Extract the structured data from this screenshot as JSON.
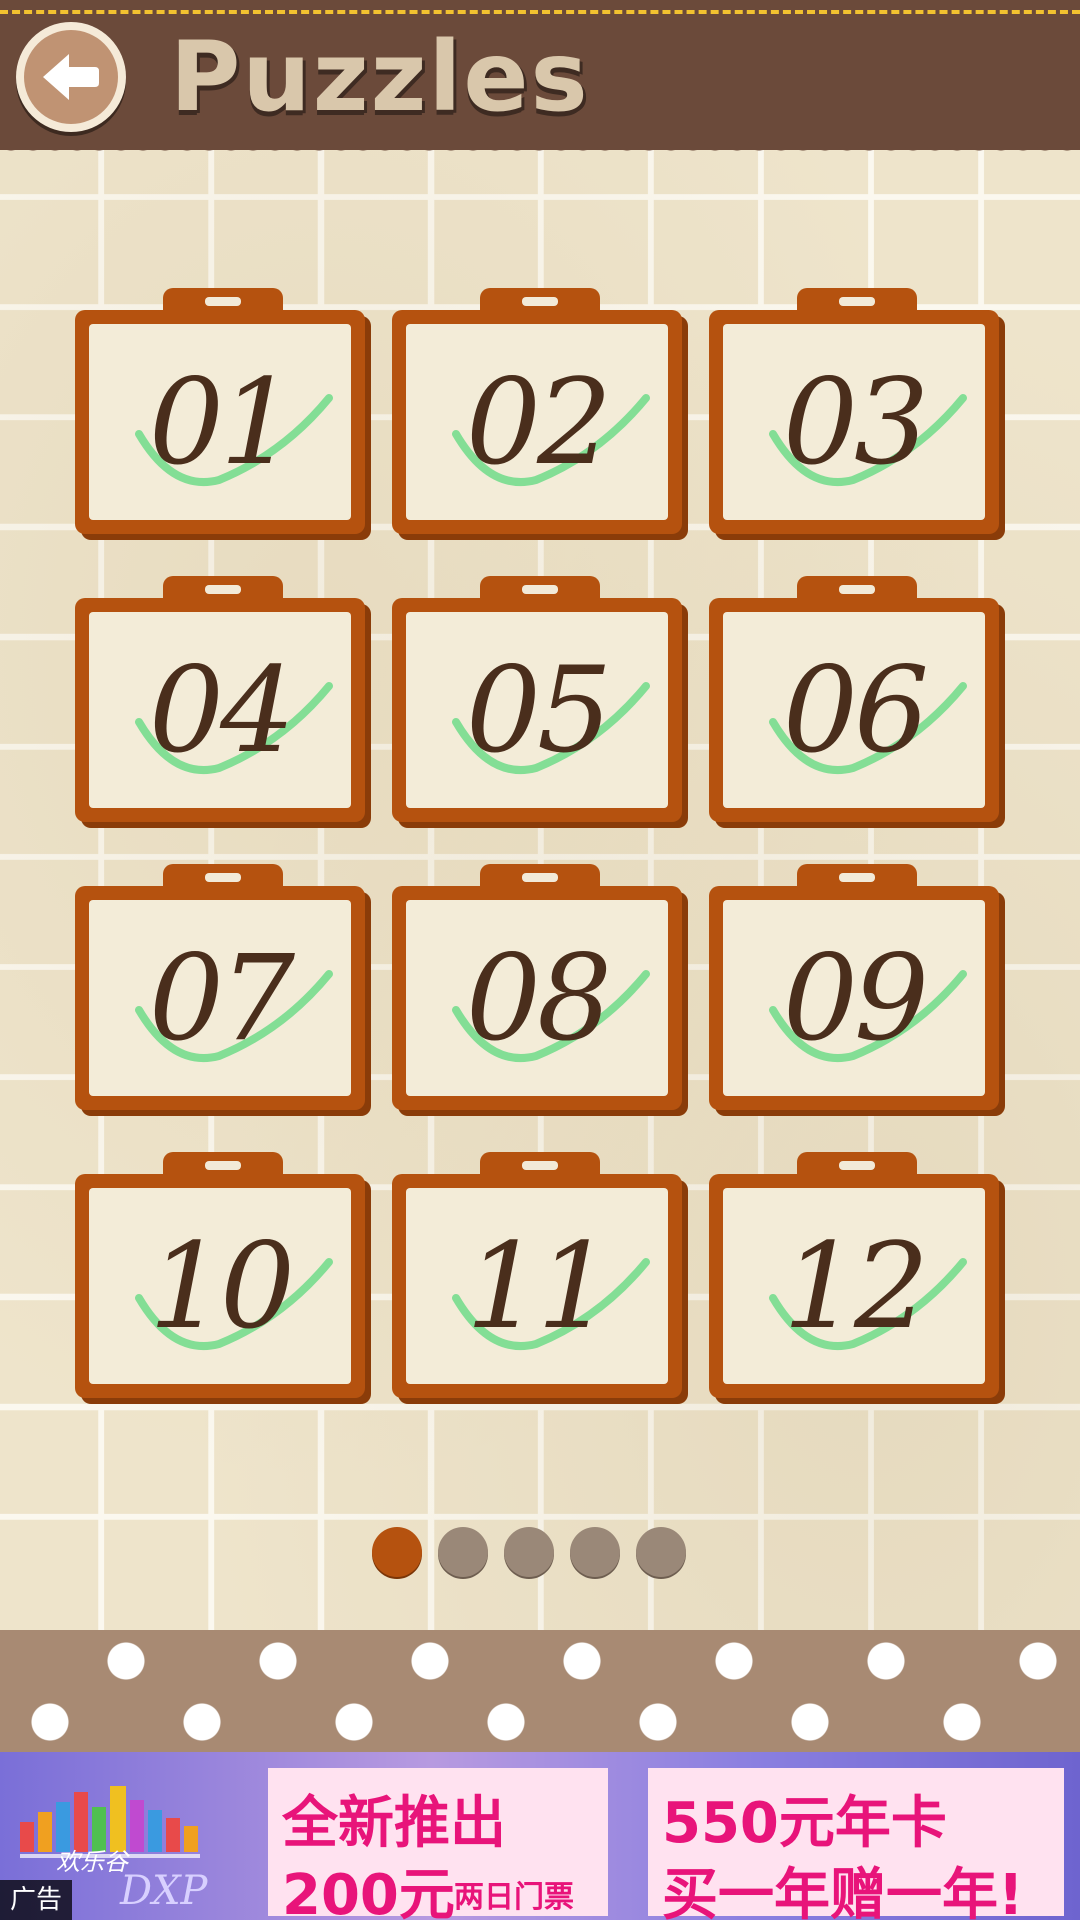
{
  "header": {
    "title": "Puzzles",
    "back_icon": "arrow-left-icon"
  },
  "puzzles": [
    {
      "label": "01",
      "completed": true
    },
    {
      "label": "02",
      "completed": true
    },
    {
      "label": "03",
      "completed": true
    },
    {
      "label": "04",
      "completed": true
    },
    {
      "label": "05",
      "completed": true
    },
    {
      "label": "06",
      "completed": true
    },
    {
      "label": "07",
      "completed": true
    },
    {
      "label": "08",
      "completed": true
    },
    {
      "label": "09",
      "completed": true
    },
    {
      "label": "10",
      "completed": true
    },
    {
      "label": "11",
      "completed": true
    },
    {
      "label": "12",
      "completed": true
    }
  ],
  "pager": {
    "pages": 5,
    "current": 1
  },
  "ad": {
    "logo_text": "欢乐谷",
    "logo_sub": "DXP",
    "left_line1": "全新推出",
    "left_line2": "200元",
    "left_line2_small": "两日门票",
    "right_line1": "550元年卡",
    "right_line2": "买一年赠一年!",
    "label": "广告"
  },
  "colors": {
    "header": "#6b4a3a",
    "board": "#b5520f",
    "check": "#6fdc8a",
    "dot_active": "#b5520f",
    "dot_inactive": "#9a8878"
  }
}
